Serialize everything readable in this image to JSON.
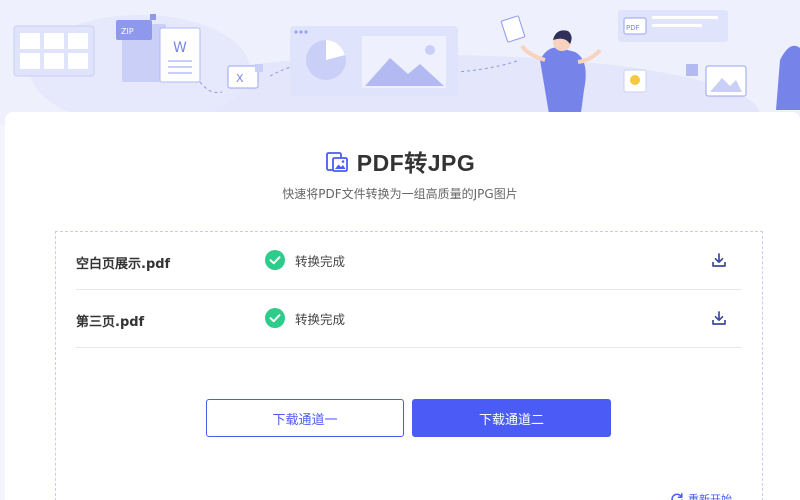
{
  "header": {
    "title": "PDF转JPG",
    "subtitle": "快速将PDF文件转换为一组高质量的JPG图片",
    "banner_labels": {
      "zip": "ZIP",
      "word": "W",
      "excel": "X",
      "pdf": "PDF"
    }
  },
  "files": [
    {
      "name": "空白页展示.pdf",
      "status": "转换完成",
      "status_icon": "check-circle-icon",
      "action_icon": "download-icon"
    },
    {
      "name": "第三页.pdf",
      "status": "转换完成",
      "status_icon": "check-circle-icon",
      "action_icon": "download-icon"
    }
  ],
  "buttons": {
    "download_channel_1": "下载通道一",
    "download_channel_2": "下载通道二"
  },
  "restart": {
    "label": "重新开始",
    "icon": "refresh-icon"
  },
  "colors": {
    "accent": "#4a5cf5",
    "success": "#2ecc8b",
    "banner_bg": "#eef0fd"
  }
}
